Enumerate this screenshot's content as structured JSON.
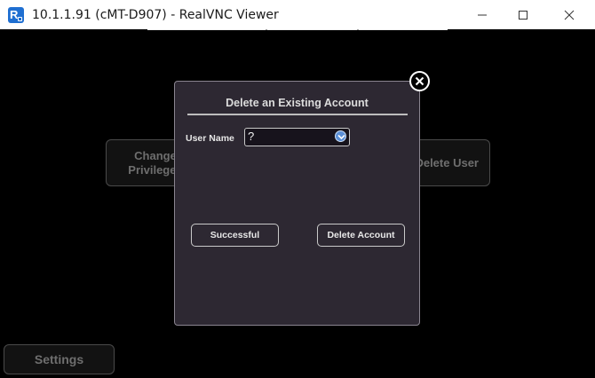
{
  "window": {
    "title": "10.1.1.91 (cMT-D907) - RealVNC Viewer",
    "app_icon_letter": "R"
  },
  "background": {
    "change_privileges_line1": "Change",
    "change_privileges_line2": "Privileges",
    "delete_user_label": "Delete User",
    "settings_label": "Settings"
  },
  "dialog": {
    "title": "Delete an Existing Account",
    "user_name_label": "User Name",
    "user_name_value": "?",
    "successful_label": "Successful",
    "delete_account_label": "Delete Account"
  },
  "colors": {
    "dialog_bg": "#2d2832",
    "dropdown_accent": "#5b8fd6",
    "screen_bg": "#000000"
  },
  "icons": {
    "app": "realvnc-icon",
    "minimize": "minimize-icon",
    "maximize": "maximize-icon",
    "close": "close-icon",
    "dropdown": "chevron-down-icon",
    "dialog_close": "close-circle-icon"
  }
}
